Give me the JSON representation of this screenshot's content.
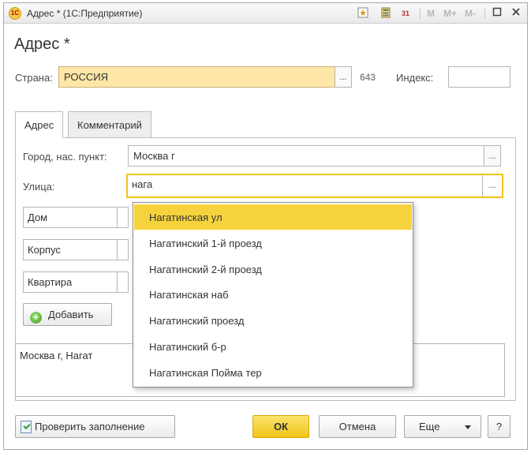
{
  "window": {
    "title": "Адрес * (1С:Предприятие)",
    "logo_text": "1C",
    "toolbar_icons": [
      "favorite-icon",
      "calculator-icon",
      "calendar-icon"
    ],
    "memory_buttons": [
      "M",
      "M+",
      "M-"
    ],
    "calendar_label": "31"
  },
  "form": {
    "title": "Адрес *",
    "country_label": "Страна:",
    "country_value": "РОССИЯ",
    "country_code": "643",
    "index_label": "Индекс:",
    "index_value": ""
  },
  "tabs": [
    {
      "label": "Адрес",
      "active": true
    },
    {
      "label": "Комментарий",
      "active": false
    }
  ],
  "address": {
    "city_label": "Город, нас. пункт:",
    "city_value": "Москва г",
    "street_label": "Улица:",
    "street_value": "нага",
    "house_label": "Дом",
    "building_label": "Корпус",
    "apartment_label": "Квартира",
    "add_button": "Добавить",
    "preview": "Москва г, Нагат"
  },
  "suggestions": [
    "Нагатинская ул",
    "Нагатинский 1-й проезд",
    "Нагатинский 2-й проезд",
    "Нагатинская наб",
    "Нагатинский проезд",
    "Нагатинский б-р",
    "Нагатинская Пойма тер"
  ],
  "footer": {
    "check_button": "Проверить заполнение",
    "ok_button": "ОК",
    "cancel_button": "Отмена",
    "more_button": "Еще",
    "help_button": "?"
  },
  "pick_button_label": "...",
  "colors": {
    "accent_yellow": "#f0c419",
    "selected_row": "#f6d33c",
    "country_field_bg": "#fde6a6"
  }
}
